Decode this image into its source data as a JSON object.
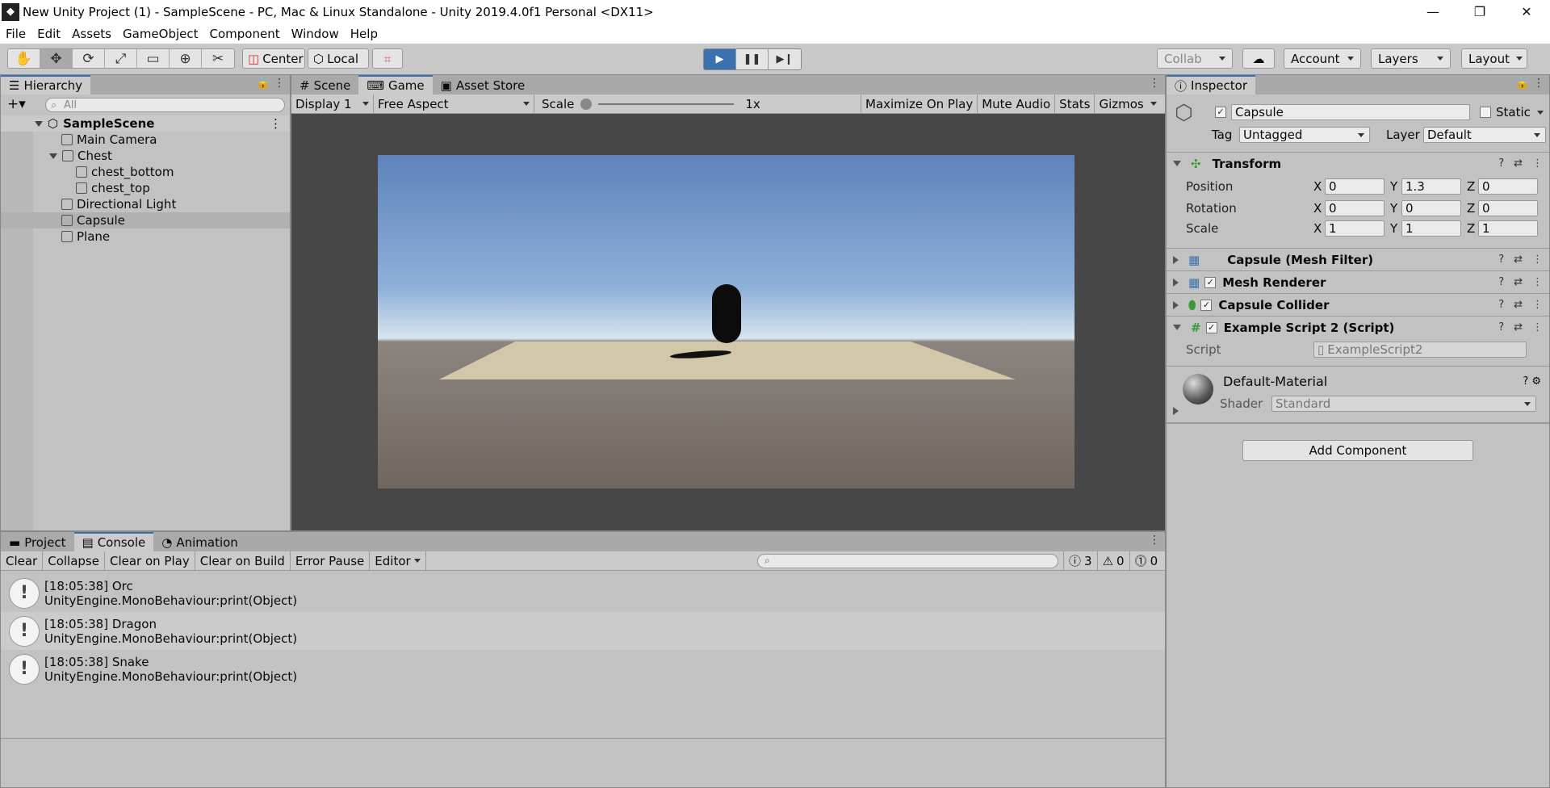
{
  "window": {
    "title": "New Unity Project (1) - SampleScene - PC, Mac & Linux Standalone - Unity 2019.4.0f1 Personal <DX11>"
  },
  "menu": [
    "File",
    "Edit",
    "Assets",
    "GameObject",
    "Component",
    "Window",
    "Help"
  ],
  "toolbar": {
    "pivot": "Center",
    "space": "Local",
    "collab": "Collab",
    "account": "Account",
    "layers": "Layers",
    "layout": "Layout"
  },
  "hierarchy": {
    "tab": "Hierarchy",
    "search_placeholder": "All",
    "scene": "SampleScene",
    "items": [
      "Main Camera",
      "Chest",
      "chest_bottom",
      "chest_top",
      "Directional Light",
      "Capsule",
      "Plane"
    ]
  },
  "center_tabs": {
    "scene": "Scene",
    "game": "Game",
    "store": "Asset Store"
  },
  "gamebar": {
    "display": "Display 1",
    "aspect": "Free Aspect",
    "scale_label": "Scale",
    "scale_value": "1x",
    "maximize": "Maximize On Play",
    "mute": "Mute Audio",
    "stats": "Stats",
    "gizmos": "Gizmos"
  },
  "bottom_tabs": {
    "project": "Project",
    "console": "Console",
    "animation": "Animation"
  },
  "console": {
    "clear": "Clear",
    "collapse": "Collapse",
    "clear_on_play": "Clear on Play",
    "clear_on_build": "Clear on Build",
    "error_pause": "Error Pause",
    "editor": "Editor",
    "count_log": "3",
    "count_warn": "0",
    "count_err": "0",
    "logs": [
      {
        "line1": "[18:05:38] Orc",
        "line2": "UnityEngine.MonoBehaviour:print(Object)"
      },
      {
        "line1": "[18:05:38] Dragon",
        "line2": "UnityEngine.MonoBehaviour:print(Object)"
      },
      {
        "line1": "[18:05:38] Snake",
        "line2": "UnityEngine.MonoBehaviour:print(Object)"
      }
    ]
  },
  "inspector": {
    "tab": "Inspector",
    "name": "Capsule",
    "static": "Static",
    "tag_label": "Tag",
    "tag": "Untagged",
    "layer_label": "Layer",
    "layer": "Default",
    "transform": "Transform",
    "position": {
      "label": "Position",
      "x": "0",
      "y": "1.3",
      "z": "0"
    },
    "rotation": {
      "label": "Rotation",
      "x": "0",
      "y": "0",
      "z": "0"
    },
    "scale": {
      "label": "Scale",
      "x": "1",
      "y": "1",
      "z": "1"
    },
    "components": [
      "Capsule (Mesh Filter)",
      "Mesh Renderer",
      "Capsule Collider",
      "Example Script 2 (Script)"
    ],
    "script_label": "Script",
    "script_value": "ExampleScript2",
    "material": "Default-Material",
    "shader_label": "Shader",
    "shader": "Standard",
    "add_component": "Add Component"
  },
  "axis_labels": {
    "x": "X",
    "y": "Y",
    "z": "Z"
  }
}
